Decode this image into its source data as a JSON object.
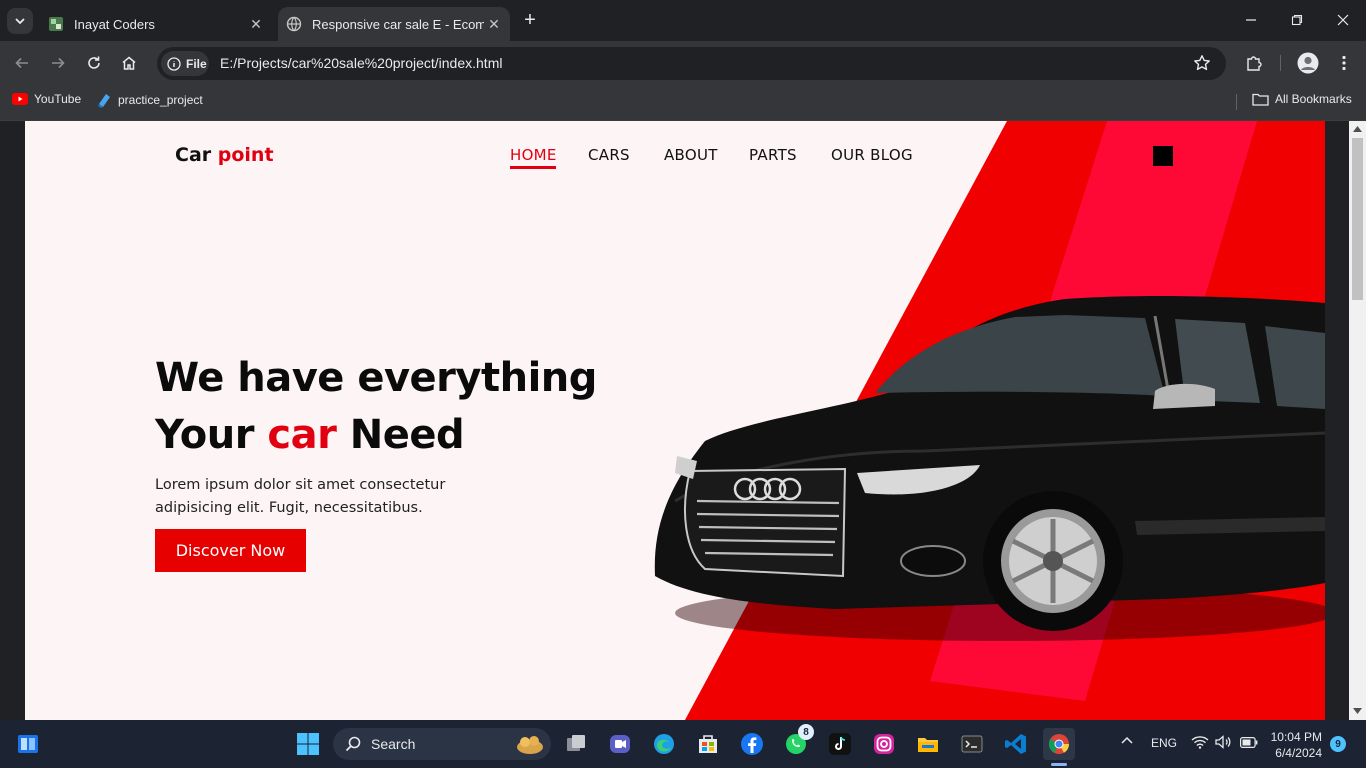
{
  "browser": {
    "tabs": [
      {
        "title": "Inayat Coders",
        "active": false
      },
      {
        "title": "Responsive car sale E - Ecomme",
        "active": true
      }
    ],
    "omnibox": {
      "chip": "File",
      "url": "E:/Projects/car%20sale%20project/index.html"
    },
    "bookmarks": [
      {
        "label": "YouTube",
        "icon": "youtube-icon"
      },
      {
        "label": "practice_project",
        "icon": "blue-page-icon"
      }
    ],
    "all_bookmarks": "All Bookmarks"
  },
  "site": {
    "logo": {
      "main": "Car",
      "accent": "point"
    },
    "nav": [
      {
        "label": "HOME",
        "active": true
      },
      {
        "label": "CARS",
        "active": false
      },
      {
        "label": "ABOUT",
        "active": false
      },
      {
        "label": "PARTS",
        "active": false
      },
      {
        "label": "OUR BLOG",
        "active": false
      }
    ],
    "hero": {
      "line1": "We have everything",
      "line2_pre": "Your",
      "line2_accent": "car",
      "line2_post": "Need",
      "description": "Lorem ipsum dolor sit amet consectetur adipisicing elit. Fugit, necessitatibus.",
      "cta": "Discover Now"
    },
    "colors": {
      "accent": "#e10010",
      "background": "#fdf4f5",
      "stripe": "#f00020"
    }
  },
  "taskbar": {
    "search": "Search",
    "whatsapp_badge": "8",
    "tray": {
      "language": "ENG",
      "time": "10:04 PM",
      "date": "6/4/2024",
      "notifications": "9"
    }
  }
}
